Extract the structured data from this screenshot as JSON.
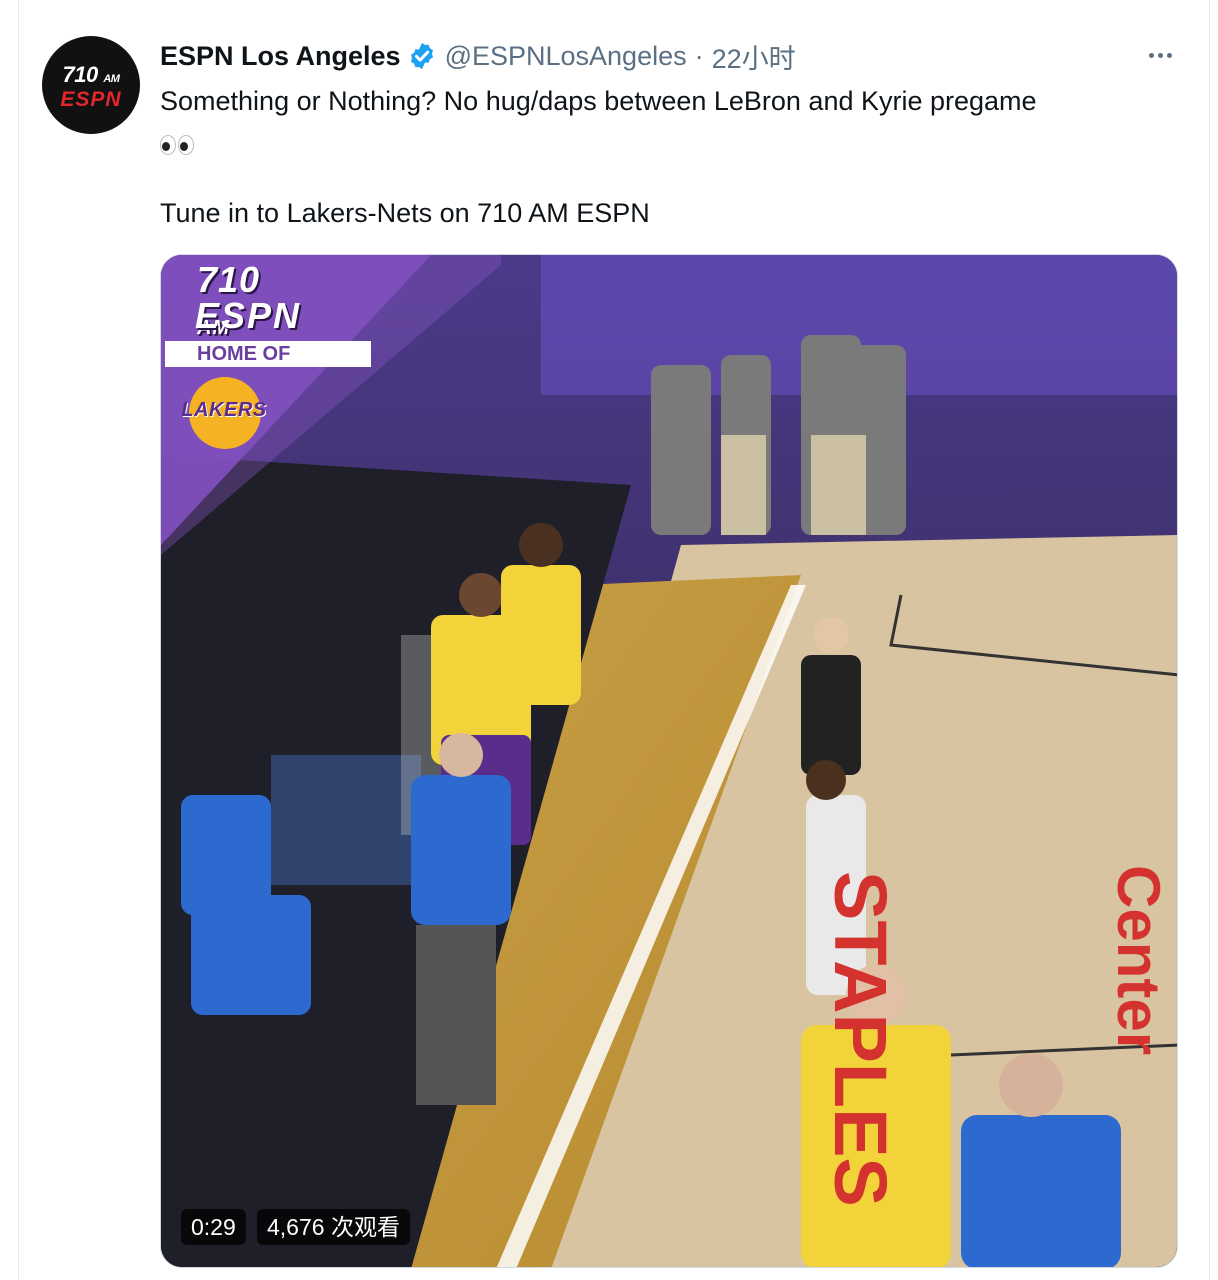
{
  "tweet": {
    "author_name": "ESPN Los Angeles",
    "handle": "@ESPNLosAngeles",
    "separator": "·",
    "time": "22小时",
    "text_line1": "Something or Nothing? No hug/daps between LeBron and Kyrie pregame",
    "text_line2": "Tune in to Lakers-Nets on 710 AM ESPN",
    "verified_icon": "verified-badge-icon",
    "more_icon": "more-options-icon"
  },
  "avatar": {
    "top_text": "710",
    "top_small": "AM",
    "bottom_text": "ESPN"
  },
  "video": {
    "duration": "0:29",
    "views": "4,676 次观看",
    "overlay": {
      "line1": "710",
      "line1_small": "AM",
      "line2": "ESPN",
      "home_of": "HOME OF",
      "team": "LAKERS"
    },
    "court_text_1": "STAPLES",
    "court_text_2": "Center"
  },
  "colors": {
    "verified": "#1da1f2",
    "text": "#0f1419",
    "secondary": "#5b7083",
    "lakers_purple": "#5a2d8c",
    "lakers_gold": "#f5b324"
  }
}
